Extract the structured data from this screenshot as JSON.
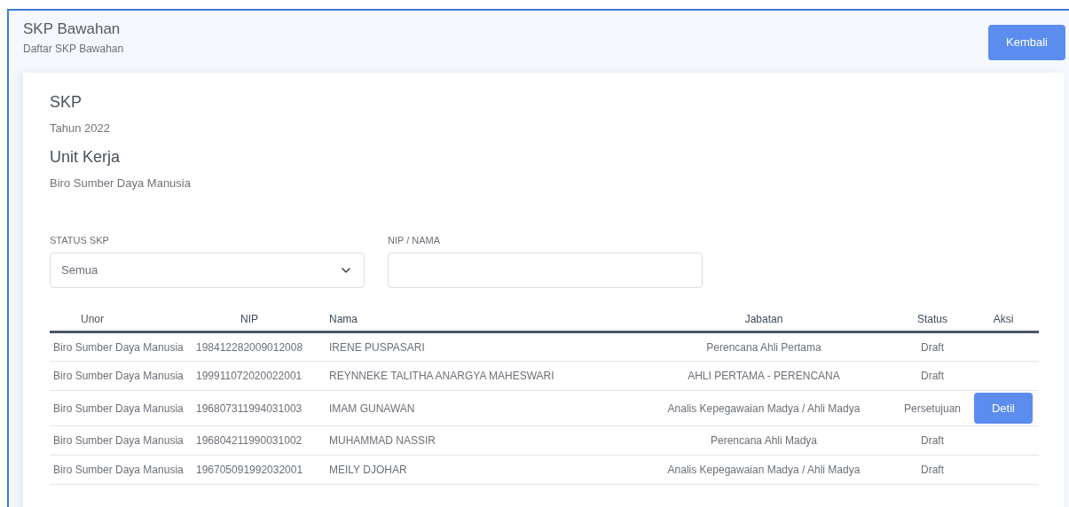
{
  "header": {
    "title": "SKP Bawahan",
    "subtitle": "Daftar SKP Bawahan",
    "back_button": "Kembali"
  },
  "info": {
    "skp_title": "SKP",
    "year": "Tahun 2022",
    "unit_title": "Unit Kerja",
    "unit": "Biro Sumber Daya Manusia"
  },
  "filters": {
    "status_label": "STATUS SKP",
    "status_value": "Semua",
    "search_label": "NIP / NAMA"
  },
  "table": {
    "columns": [
      "Unor",
      "NIP",
      "Nama",
      "Jabatan",
      "Status",
      "Aksi"
    ],
    "rows": [
      {
        "unor": "Biro Sumber Daya Manusia",
        "nip": "198412282009012008",
        "nama": "IRENE PUSPASARI",
        "jabatan": "Perencana Ahli Pertama",
        "status": "Draft"
      },
      {
        "unor": "Biro Sumber Daya Manusia",
        "nip": "199911072020022001",
        "nama": "REYNNEKE TALITHA ANARGYA MAHESWARI",
        "jabatan": "AHLI PERTAMA - PERENCANA",
        "status": "Draft"
      },
      {
        "unor": "Biro Sumber Daya Manusia",
        "nip": "196807311994031003",
        "nama": "IMAM GUNAWAN",
        "jabatan": "Analis Kepegawaian Madya / Ahli Madya",
        "status": "Persetujuan",
        "action": "Detil"
      },
      {
        "unor": "Biro Sumber Daya Manusia",
        "nip": "196804211990031002",
        "nama": "MUHAMMAD NASSIR",
        "jabatan": "Perencana Ahli Madya",
        "status": "Draft"
      },
      {
        "unor": "Biro Sumber Daya Manusia",
        "nip": "196705091992032001",
        "nama": "MEILY DJOHAR",
        "jabatan": "Analis Kepegawaian Madya / Ahli Madya",
        "status": "Draft"
      }
    ]
  }
}
